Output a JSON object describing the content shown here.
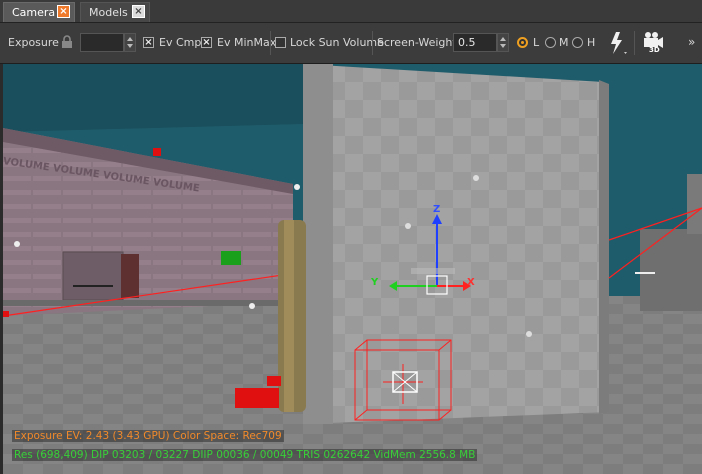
{
  "tabs": [
    {
      "label": "Camera",
      "active": true
    },
    {
      "label": "Models",
      "active": false
    }
  ],
  "toolbar": {
    "exposure_label": "Exposure",
    "exposure_value": "",
    "ev_cmp_label": "Ev Cmp",
    "ev_cmp_checked": true,
    "ev_minmax_label": "Ev MinMax",
    "ev_minmax_checked": true,
    "lock_sun_label": "Lock Sun Volume",
    "lock_sun_checked": false,
    "screen_weight_label": "Screen-Weight",
    "screen_weight_value": "0.5",
    "lod": {
      "l": "L",
      "m": "M",
      "h": "H",
      "selected": "L"
    },
    "camera_mode_badge": "3D",
    "overflow": "»"
  },
  "viewport": {
    "gizmo_axes": {
      "x": "X",
      "y": "Y",
      "z": "Z"
    },
    "wall_text": "VOLUME VOLUME VOLUME VOLUME",
    "colors": {
      "sky": "#1f5c6b",
      "floor": "#8a8a8a",
      "selection": "#ff2020",
      "axis_x": "#ff2020",
      "axis_y": "#20d020",
      "axis_z": "#2040ff"
    }
  },
  "status": {
    "line1": "Exposure EV: 2.43 (3.43 GPU)  Color Space: Rec709",
    "line2": "Res (698,409)   DIP 03203 / 03227  DIIP 00036 / 00049  TRIS 0262642  VidMem 2556.8 MB"
  }
}
